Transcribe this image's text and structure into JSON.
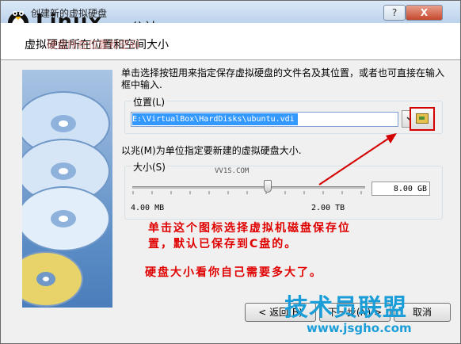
{
  "window": {
    "title": "创建新的虚拟硬盘",
    "help": "?",
    "close": "X"
  },
  "watermark": {
    "logo_text": "Linux",
    "logo_cn": "公社",
    "header_overlay": "硬盘所在位置和空间",
    "bottom_cn": "技术员联盟",
    "bottom_url": "www.jsgho.com",
    "slider_mark": "VV1S.COM"
  },
  "header": {
    "title": "虚拟硬盘所在位置和空间大小"
  },
  "desc": "单击选择按钮用来指定保存虚拟硬盘的文件名及其位置，或者也可直接在输入框中输入.",
  "location": {
    "label": "位置(L)",
    "value": "E:\\VirtualBox\\HardDisks\\ubuntu.vdi"
  },
  "size": {
    "hint": "以兆(M)为单位指定要新建的虚拟硬盘大小.",
    "label": "大小(S)",
    "min": "4.00 MB",
    "max": "2.00 TB",
    "value": "8.00 GB"
  },
  "annotation": {
    "line1": "单击这个图标选择虚拟机磁盘保存位",
    "line2": "置，默认已保存到C盘的。",
    "line3": "硬盘大小看你自己需要多大了。"
  },
  "buttons": {
    "back": "< 返回(B)",
    "next": "下一步(N) >",
    "cancel": "取消"
  }
}
